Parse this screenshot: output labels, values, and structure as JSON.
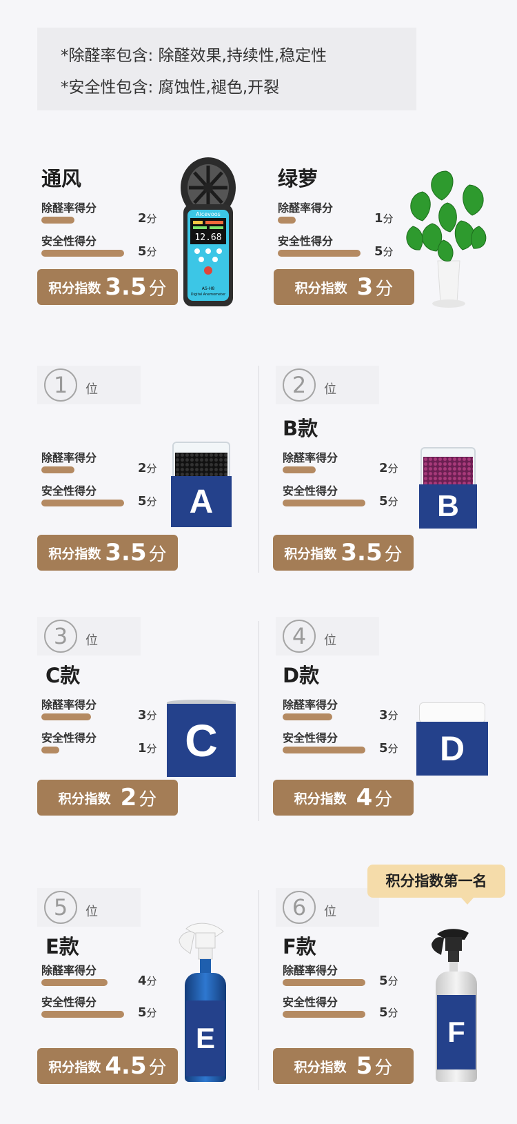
{
  "notes": [
    "*除醛率包含: 除醛效果,持续性,稳定性",
    "*安全性包含: 腐蚀性,褪色,开裂"
  ],
  "labels": {
    "removal": "除醛率得分",
    "safety": "安全性得分",
    "index": "积分指数",
    "unit": "分",
    "rank_suffix": "位"
  },
  "badge": "积分指数第一名",
  "meter_brand": "Aicevoos",
  "meter_model": "AS-H8",
  "meter_caption": "Digital Anemometer",
  "meter_reading": "12.68",
  "items": [
    {
      "title": "通风",
      "removal": "2",
      "safety": "5",
      "index": "3.5",
      "removal_ratio": 0.4,
      "safety_ratio": 1.0
    },
    {
      "title": "绿萝",
      "removal": "1",
      "safety": "5",
      "index": "3",
      "removal_ratio": 0.2,
      "safety_ratio": 1.0
    },
    {
      "rank": "1",
      "title": "",
      "letter": "A",
      "removal": "2",
      "safety": "5",
      "index": "3.5",
      "removal_ratio": 0.4,
      "safety_ratio": 1.0
    },
    {
      "rank": "2",
      "title": "B款",
      "letter": "B",
      "removal": "2",
      "safety": "5",
      "index": "3.5",
      "removal_ratio": 0.4,
      "safety_ratio": 1.0
    },
    {
      "rank": "3",
      "title": "C款",
      "letter": "C",
      "removal": "3",
      "safety": "1",
      "index": "2",
      "removal_ratio": 0.6,
      "safety_ratio": 0.2
    },
    {
      "rank": "4",
      "title": "D款",
      "letter": "D",
      "removal": "3",
      "safety": "5",
      "index": "4",
      "removal_ratio": 0.6,
      "safety_ratio": 1.0
    },
    {
      "rank": "5",
      "title": "E款",
      "letter": "E",
      "removal": "4",
      "safety": "5",
      "index": "4.5",
      "removal_ratio": 0.8,
      "safety_ratio": 1.0
    },
    {
      "rank": "6",
      "title": "F款",
      "letter": "F",
      "removal": "5",
      "safety": "5",
      "index": "5",
      "removal_ratio": 1.0,
      "safety_ratio": 1.0
    }
  ]
}
